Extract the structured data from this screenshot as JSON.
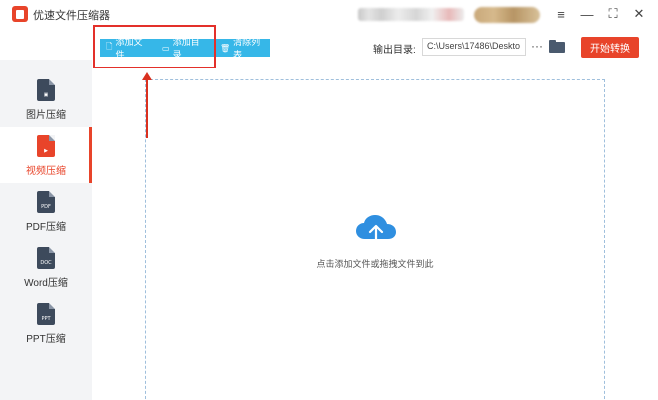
{
  "app": {
    "title": "优速文件压缩器"
  },
  "toolbar": {
    "add_file_label": "添加文件",
    "add_dir_label": "添加目录",
    "clear_label": "清除列表",
    "output_dir_label": "输出目录:",
    "output_path": "C:\\Users\\17486\\Deskto",
    "more_label": "···",
    "start_label": "开始转换"
  },
  "sidebar": {
    "items": [
      {
        "label": "图片压缩",
        "glyph": "▣",
        "active": false
      },
      {
        "label": "视频压缩",
        "glyph": "▶",
        "active": true
      },
      {
        "label": "PDF压缩",
        "glyph": "PDF",
        "active": false
      },
      {
        "label": "Word压缩",
        "glyph": "DOC",
        "active": false
      },
      {
        "label": "PPT压缩",
        "glyph": "PPT",
        "active": false
      }
    ]
  },
  "main": {
    "drop_hint": "点击添加文件或拖拽文件到此"
  },
  "colors": {
    "accent": "#e8442a",
    "button_blue": "#36b7e8",
    "annotation_red": "#e3302a"
  },
  "window_controls": {
    "menu": "≡",
    "minimize": "—",
    "maximize": "⛶",
    "close": "✕"
  }
}
